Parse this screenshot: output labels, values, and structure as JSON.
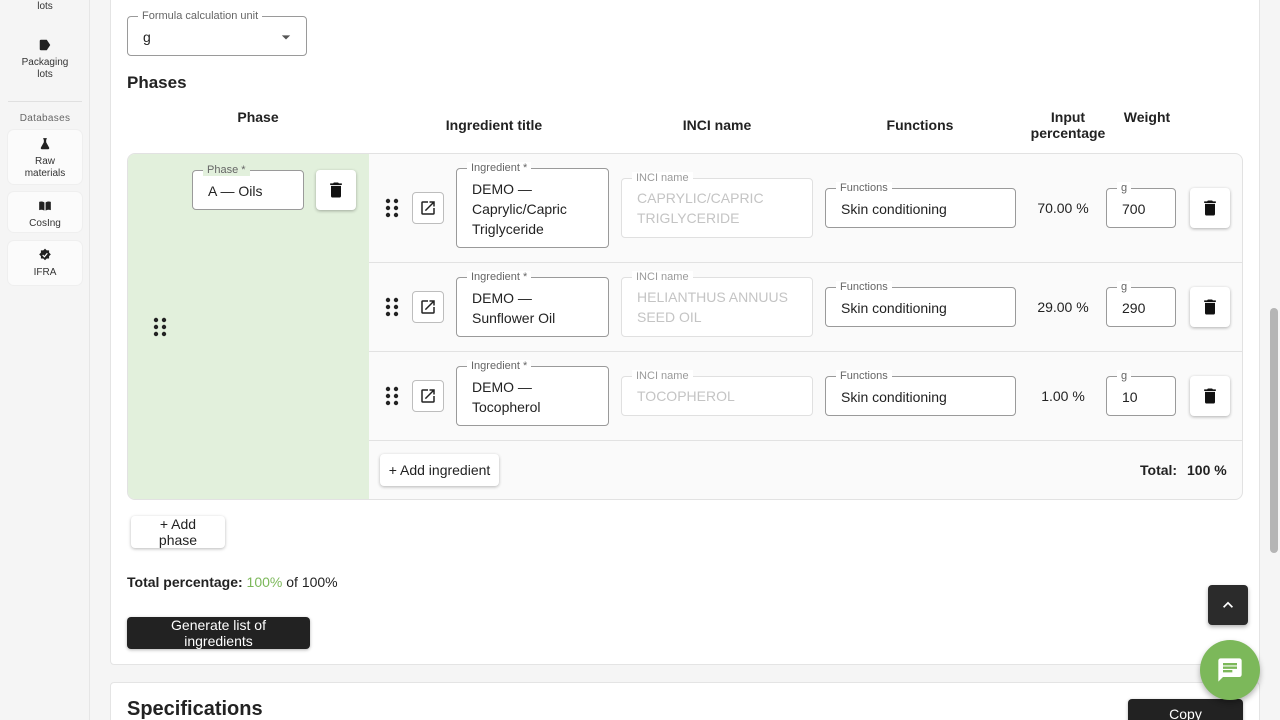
{
  "sidebar": {
    "items": [
      {
        "label": "lots",
        "icon": "box-icon"
      },
      {
        "label": "Packaging lots",
        "icon": "tag-icon"
      },
      {
        "label": "Raw materials",
        "icon": "flask-icon"
      },
      {
        "label": "CosIng",
        "icon": "book-icon"
      },
      {
        "label": "IFRA",
        "icon": "verified-icon"
      }
    ],
    "section_databases": "Databases"
  },
  "formula_unit": {
    "label": "Formula calculation unit",
    "value": "g"
  },
  "phases_heading": "Phases",
  "columns": {
    "phase": "Phase",
    "ingredient": "Ingredient title",
    "inci": "INCI name",
    "functions": "Functions",
    "input_pct": "Input percentage",
    "weight": "Weight"
  },
  "phase": {
    "label": "Phase *",
    "value": "A — Oils",
    "ingredients": [
      {
        "ingredient_label": "Ingredient *",
        "title": "DEMO — Caprylic/Capric Triglyceride",
        "inci_label": "INCI name",
        "inci": "CAPRYLIC/CAPRIC TRIGLYCERIDE",
        "functions_label": "Functions",
        "functions": "Skin conditioning",
        "pct": "70.00 %",
        "weight_label": "g",
        "weight": "700"
      },
      {
        "ingredient_label": "Ingredient *",
        "title": "DEMO — Sunflower Oil",
        "inci_label": "INCI name",
        "inci": "HELIANTHUS ANNUUS SEED OIL",
        "functions_label": "Functions",
        "functions": "Skin conditioning",
        "pct": "29.00 %",
        "weight_label": "g",
        "weight": "290"
      },
      {
        "ingredient_label": "Ingredient *",
        "title": "DEMO — Tocopherol",
        "inci_label": "INCI name",
        "inci": "TOCOPHEROL",
        "functions_label": "Functions",
        "functions": "Skin conditioning",
        "pct": "1.00 %",
        "weight_label": "g",
        "weight": "10"
      }
    ],
    "add_ingredient": "+ Add ingredient",
    "total_label": "Total:",
    "total_value": "100 %"
  },
  "add_phase": "+ Add phase",
  "total_percentage": {
    "label": "Total percentage:",
    "value": "100%",
    "suffix": "of 100%"
  },
  "generate_button": "Generate list of ingredients",
  "specifications": {
    "title": "Specifications",
    "copy_button": "Copy procedure"
  },
  "colors": {
    "accent_green": "#7cb85a",
    "phase_bg": "#e2f0dc",
    "dark": "#222222"
  }
}
